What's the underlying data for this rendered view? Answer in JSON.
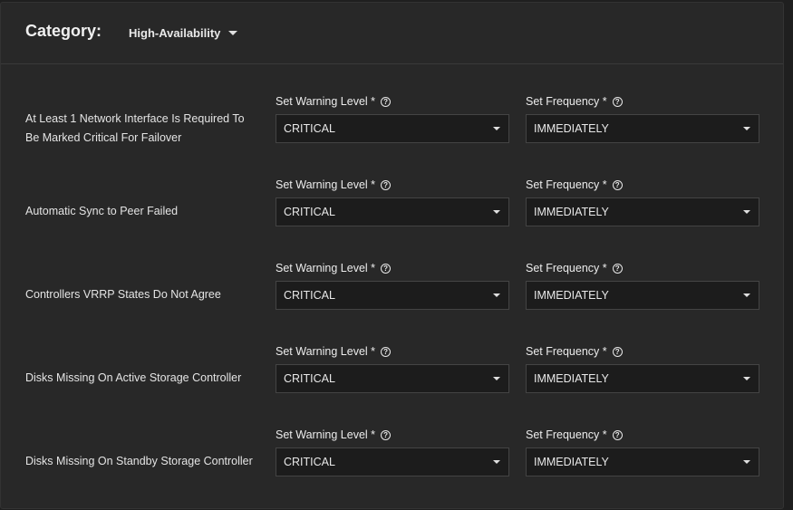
{
  "header": {
    "title": "Category:",
    "category_value": "High-Availability"
  },
  "rows": [
    {
      "label": "At Least 1 Network Interface Is Required To Be Marked Critical For Failover",
      "warning_label": "Set Warning Level",
      "warning_value": "CRITICAL",
      "frequency_label": "Set Frequency",
      "frequency_value": "IMMEDIATELY"
    },
    {
      "label": "Automatic Sync to Peer Failed",
      "warning_label": "Set Warning Level",
      "warning_value": "CRITICAL",
      "frequency_label": "Set Frequency",
      "frequency_value": "IMMEDIATELY"
    },
    {
      "label": "Controllers VRRP States Do Not Agree",
      "warning_label": "Set Warning Level",
      "warning_value": "CRITICAL",
      "frequency_label": "Set Frequency",
      "frequency_value": "IMMEDIATELY"
    },
    {
      "label": "Disks Missing On Active Storage Controller",
      "warning_label": "Set Warning Level",
      "warning_value": "CRITICAL",
      "frequency_label": "Set Frequency",
      "frequency_value": "IMMEDIATELY"
    },
    {
      "label": "Disks Missing On Standby Storage Controller",
      "warning_label": "Set Warning Level",
      "warning_value": "CRITICAL",
      "frequency_label": "Set Frequency",
      "frequency_value": "IMMEDIATELY"
    }
  ],
  "required_marker": "*",
  "help_glyph": "?",
  "icons": {
    "help": "help-circle-icon",
    "dropdown": "chevron-down-icon"
  },
  "colors": {
    "card_bg": "#282828",
    "input_bg": "#1c1c1c",
    "text": "#e6e6e6"
  }
}
